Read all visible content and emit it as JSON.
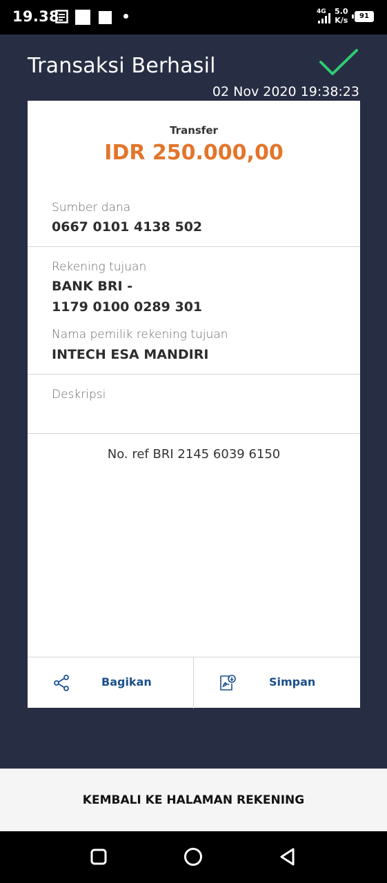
{
  "status_bar": {
    "time": "19.38",
    "network": "4G",
    "speed_value": "5.0",
    "speed_unit": "K/s",
    "battery": "91"
  },
  "header": {
    "title": "Transaksi Berhasil",
    "timestamp": "02 Nov 2020 19:38:23",
    "status_icon": "checkmark-icon"
  },
  "transaction": {
    "type": "Transfer",
    "amount": "IDR 250.000,00",
    "source_label": "Sumber dana",
    "source_value": "0667 0101 4138 502",
    "dest_label": "Rekening tujuan",
    "dest_bank": "BANK BRI -",
    "dest_account": "1179 0100 0289 301",
    "owner_label": "Nama pemilik rekening tujuan",
    "owner_value": "INTECH ESA MANDIRI",
    "desc_label": "Deskripsi",
    "ref": "No. ref BRI 2145 6039 6150"
  },
  "actions": {
    "share_label": "Bagikan",
    "save_label": "Simpan"
  },
  "footer": {
    "back_label": "KEMBALI KE HALAMAN REKENING"
  },
  "colors": {
    "background": "#272e44",
    "amount": "#e3752b",
    "action_text": "#1a4f8b",
    "check": "#2ecc71"
  }
}
